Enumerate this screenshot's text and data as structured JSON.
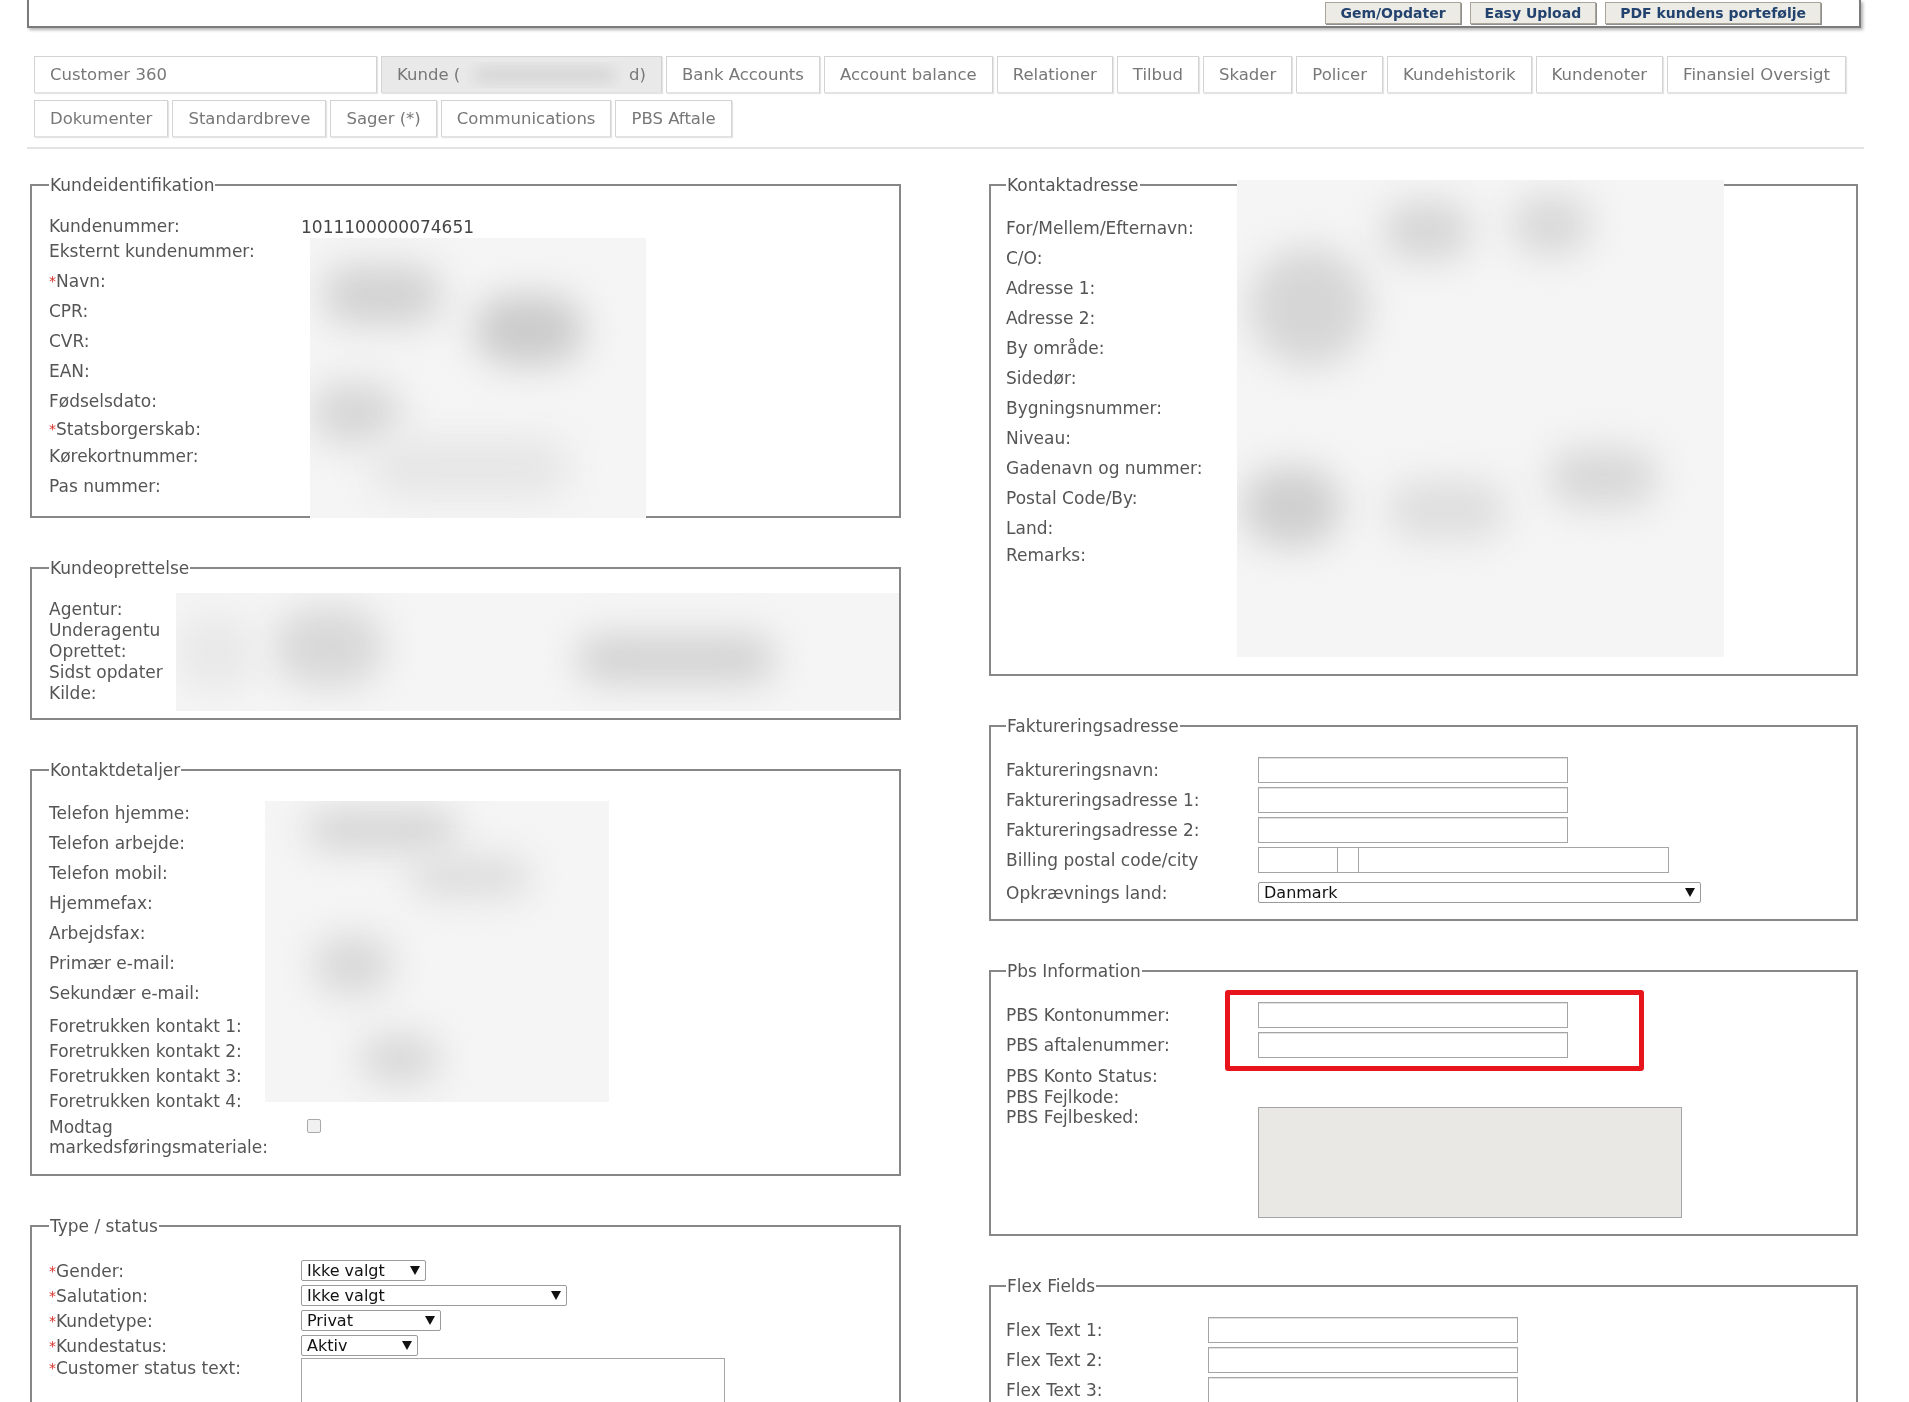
{
  "toolbar": {
    "buttons": [
      "Gem/Opdater",
      "Easy Upload",
      "PDF kundens portefølje"
    ]
  },
  "tab_rows": [
    [
      {
        "label": "Customer 360",
        "selected": false,
        "redacted": false
      },
      {
        "label": "Kunde (",
        "label_end": "d)",
        "selected": true,
        "redacted": true
      },
      {
        "label": "Bank Accounts",
        "selected": false,
        "redacted": false
      },
      {
        "label": "Account balance",
        "selected": false,
        "redacted": false
      },
      {
        "label": "Relationer",
        "selected": false,
        "redacted": false
      },
      {
        "label": "Tilbud",
        "selected": false,
        "redacted": false
      },
      {
        "label": "Skader",
        "selected": false,
        "redacted": false
      },
      {
        "label": "Policer",
        "selected": false,
        "redacted": false
      },
      {
        "label": "Kundehistorik",
        "selected": false,
        "redacted": false
      },
      {
        "label": "Kundenoter",
        "selected": false,
        "redacted": false
      },
      {
        "label": "Finansiel Oversigt",
        "selected": false,
        "redacted": false
      }
    ],
    [
      {
        "label": "Dokumenter",
        "selected": false,
        "redacted": false
      },
      {
        "label": "Standardbreve",
        "selected": false,
        "redacted": false
      },
      {
        "label": "Sager (*)",
        "selected": false,
        "redacted": false
      },
      {
        "label": "Communications",
        "selected": false,
        "redacted": false
      },
      {
        "label": "PBS Aftale",
        "selected": false,
        "redacted": false
      }
    ]
  ],
  "left_column": [
    {
      "legend": "Kundeidentifikation",
      "redacted": true,
      "rows": [
        {
          "label": "Kundenummer:",
          "kind": "text",
          "value": "1011100000074651"
        },
        {
          "label": "Eksternt kundenummer:",
          "kind": "input"
        },
        {
          "label": "Navn:",
          "required_mark": "*",
          "kind": "input"
        },
        {
          "label": "CPR:",
          "kind": "input"
        },
        {
          "label": "CVR:",
          "kind": "input"
        },
        {
          "label": "EAN:",
          "kind": "input"
        },
        {
          "label": "Fødselsdato:",
          "kind": "input"
        },
        {
          "label": "Statsborgerskab:",
          "required_mark": "*",
          "kind": "select"
        },
        {
          "label": "Kørekortnummer:",
          "kind": "input"
        },
        {
          "label": "Pas nummer:",
          "kind": "input"
        }
      ]
    },
    {
      "legend": "Kundeoprettelse",
      "redacted": true,
      "rows": [
        {
          "label": "Agentur:",
          "kind": "text"
        },
        {
          "label": "Underagentu",
          "kind": "text"
        },
        {
          "label": "Oprettet:",
          "kind": "text"
        },
        {
          "label": "Sidst opdater",
          "kind": "text"
        },
        {
          "label": "Kilde:",
          "kind": "text"
        }
      ]
    },
    {
      "legend": "Kontaktdetaljer",
      "redacted": true,
      "rows": [
        {
          "label": "Telefon hjemme:",
          "kind": "input"
        },
        {
          "label": "Telefon arbejde:",
          "kind": "input"
        },
        {
          "label": "Telefon mobil:",
          "kind": "input"
        },
        {
          "label": "Hjemmefax:",
          "kind": "input"
        },
        {
          "label": "Arbejdsfax:",
          "kind": "input"
        },
        {
          "label": "Primær e-mail:",
          "kind": "input"
        },
        {
          "label": "Sekundær e-mail:",
          "kind": "input"
        },
        {
          "label": "Foretrukken kontakt 1:",
          "kind": "select"
        },
        {
          "label": "Foretrukken kontakt 2:",
          "kind": "select"
        },
        {
          "label": "Foretrukken kontakt 3:",
          "kind": "select"
        },
        {
          "label": "Foretrukken kontakt 4:",
          "kind": "select"
        },
        {
          "label": "Modtag markedsføringsmateriale:",
          "kind": "checkbox",
          "checked": false
        }
      ]
    },
    {
      "legend": "Type / status",
      "rows": [
        {
          "label": "Gender:",
          "required_mark": "*",
          "kind": "select",
          "value": "Ikke valgt"
        },
        {
          "label": "Salutation:",
          "required_mark": "*",
          "kind": "select",
          "value": "Ikke valgt"
        },
        {
          "label": "Kundetype:",
          "required_mark": "*",
          "kind": "select",
          "value": "Privat"
        },
        {
          "label": "Kundestatus:",
          "required_mark": "*",
          "kind": "select",
          "value": "Aktiv"
        },
        {
          "label": "Customer status text:",
          "required_mark": "*",
          "kind": "textarea",
          "disabled": false
        }
      ]
    }
  ],
  "right_column": [
    {
      "legend": "Kontaktadresse",
      "redacted": true,
      "rows": [
        {
          "label": "For/Mellem/Efternavn:",
          "kind": "input"
        },
        {
          "label": "C/O:",
          "kind": "input"
        },
        {
          "label": "Adresse 1:",
          "kind": "input"
        },
        {
          "label": "Adresse 2:",
          "kind": "input"
        },
        {
          "label": "By område:",
          "kind": "input"
        },
        {
          "label": "Sidedør:",
          "kind": "input"
        },
        {
          "label": "Bygningsnummer:",
          "kind": "input"
        },
        {
          "label": "Niveau:",
          "kind": "input"
        },
        {
          "label": "Gadenavn og nummer:",
          "kind": "input"
        },
        {
          "label": "Postal Code/By:",
          "kind": "input"
        },
        {
          "label": "Land:",
          "kind": "input"
        },
        {
          "label": "Remarks:",
          "kind": "textarea"
        }
      ]
    },
    {
      "legend": "Faktureringsadresse",
      "rows": [
        {
          "label": "Faktureringsnavn:",
          "kind": "input"
        },
        {
          "label": "Faktureringsadresse 1:",
          "kind": "input"
        },
        {
          "label": "Faktureringsadresse 2:",
          "kind": "input"
        },
        {
          "label": "Billing postal code/city",
          "kind": "postal"
        },
        {
          "label": "Opkrævnings land:",
          "kind": "select",
          "value": "Danmark"
        }
      ]
    },
    {
      "legend": "Pbs Information",
      "rows": [
        {
          "label": "PBS Kontonummer:",
          "kind": "input",
          "highlighted": true
        },
        {
          "label": "PBS aftalenummer:",
          "kind": "input",
          "highlighted": true
        },
        {
          "label": "PBS Konto Status:",
          "kind": "text",
          "highlighted": false
        },
        {
          "label": "PBS Fejlkode:",
          "kind": "text",
          "highlighted": false
        },
        {
          "label": "PBS Fejlbesked:",
          "kind": "textarea",
          "disabled": true,
          "highlighted": false
        }
      ]
    },
    {
      "legend": "Flex Fields",
      "rows": [
        {
          "label": "Flex Text 1:",
          "kind": "input"
        },
        {
          "label": "Flex Text 2:",
          "kind": "input"
        },
        {
          "label": "Flex Text 3:",
          "kind": "input"
        }
      ]
    }
  ]
}
